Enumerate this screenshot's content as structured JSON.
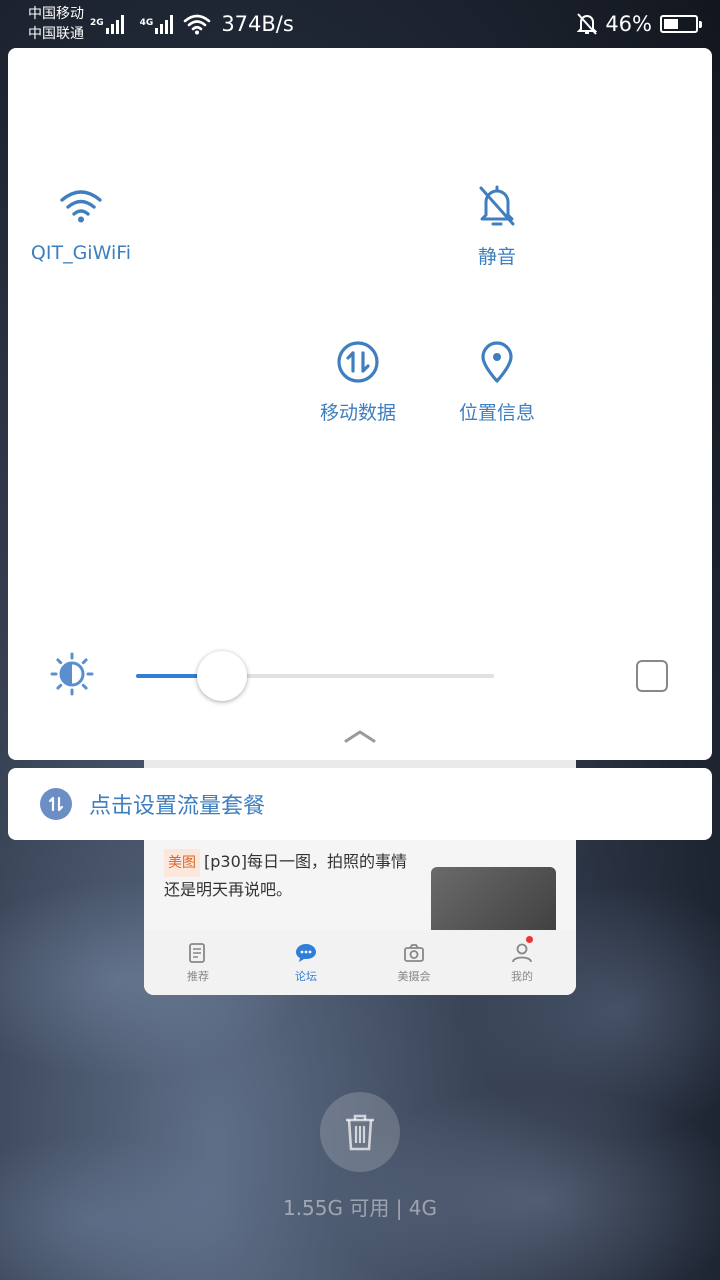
{
  "status_bar": {
    "carrier_1": "中国移动",
    "carrier_2": "中国联通",
    "net_1": "2G",
    "net_2": "4G",
    "speed": "374B/s",
    "battery": "46%",
    "battery_level": 0.46
  },
  "quick_settings": {
    "tiles": [
      {
        "label": "QIT_GiWiFi",
        "icon": "wifi-icon"
      },
      {
        "label": "静音",
        "icon": "bell-off-icon"
      },
      {
        "label": "移动数据",
        "icon": "mobile-data-icon"
      },
      {
        "label": "位置信息",
        "icon": "location-pin-icon"
      }
    ],
    "brightness_level": 0.24,
    "accent_color": "#3f7fbf"
  },
  "data_plan": {
    "label": "点击设置流量套餐"
  },
  "background_app": {
    "article_tag": "美图",
    "article_text": "[p30]每日一图，拍照的事情还是明天再说吧。",
    "tabs": [
      {
        "label": "推荐"
      },
      {
        "label": "论坛"
      },
      {
        "label": "美摄会"
      },
      {
        "label": "我的"
      }
    ]
  },
  "memory": {
    "text": "1.55G 可用 | 4G"
  }
}
